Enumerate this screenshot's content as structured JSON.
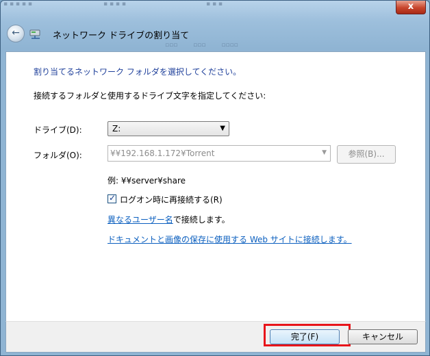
{
  "window": {
    "title": "ネットワーク ドライブの割り当て",
    "close_label": "x"
  },
  "wizard": {
    "heading": "割り当てるネットワーク フォルダを選択してください。",
    "instruction": "接続するフォルダと使用するドライブ文字を指定してください:",
    "drive_label": "ドライブ(D):",
    "drive_value": "Z:",
    "folder_label": "フォルダ(O):",
    "folder_value": "¥¥192.168.1.172¥Torrent",
    "browse_label": "参照(B)...",
    "example": "例: ¥¥server¥share",
    "reconnect_label": "ログオン時に再接続する(R)",
    "reconnect_checked": true,
    "other_user_link": "異なるユーザー名",
    "other_user_suffix": "で接続します。",
    "web_link": "ドキュメントと画像の保存に使用する Web サイトに接続します。"
  },
  "footer": {
    "finish_label": "完了(F)",
    "cancel_label": "キャンセル"
  },
  "colors": {
    "heading": "#1e3f9a",
    "link": "#0b5fbf",
    "highlight_box": "#e8141a"
  },
  "icons": {
    "back": "back-arrow-icon",
    "network_drive": "network-drive-icon",
    "close": "close-icon",
    "dropdown": "chevron-down-icon",
    "checkbox": "checkmark-icon"
  }
}
